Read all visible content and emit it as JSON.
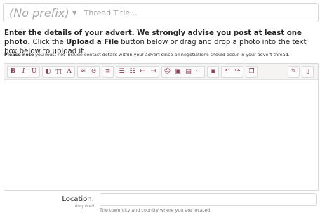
{
  "title_row": {
    "prefix": "(No prefix)",
    "placeholder": "Thread Title..."
  },
  "instructions": {
    "bold": "Enter the details of your advert. We strongly advise you post at least one photo.",
    "text1": " Click the ",
    "upload": "Upload a File",
    "text2": " button below or drag and drop a photo into the text box below to upload it."
  },
  "note": {
    "bold": "Please note",
    "text": " you must not include contact details within your advert since all negotiations should occur in your advert thread."
  },
  "toolbar": {
    "icons": [
      "bold-icon",
      "italic-icon",
      "underline-icon",
      "color-icon",
      "font-size-icon",
      "font-family-icon",
      "link-icon",
      "unlink-icon",
      "align-icon",
      "bullet-list-icon",
      "numbered-list-icon",
      "outdent-icon",
      "indent-icon",
      "smilie-icon",
      "image-icon",
      "media-icon",
      "more-icon",
      "save-draft-icon",
      "undo-icon",
      "redo-icon",
      "quote-icon",
      "remove-format-icon",
      "toggle-bbcode-icon"
    ],
    "bold": "B",
    "italic": "I",
    "underline": "U",
    "font_size": "TI",
    "font_family": "A"
  },
  "location": {
    "label": "Location:",
    "required": "Required",
    "hint": "The town/city and country where you are located."
  },
  "colors": {
    "accent": "#8a3a52",
    "border": "#d8d8d8",
    "toolbar_bg": "#f6f4f3"
  }
}
